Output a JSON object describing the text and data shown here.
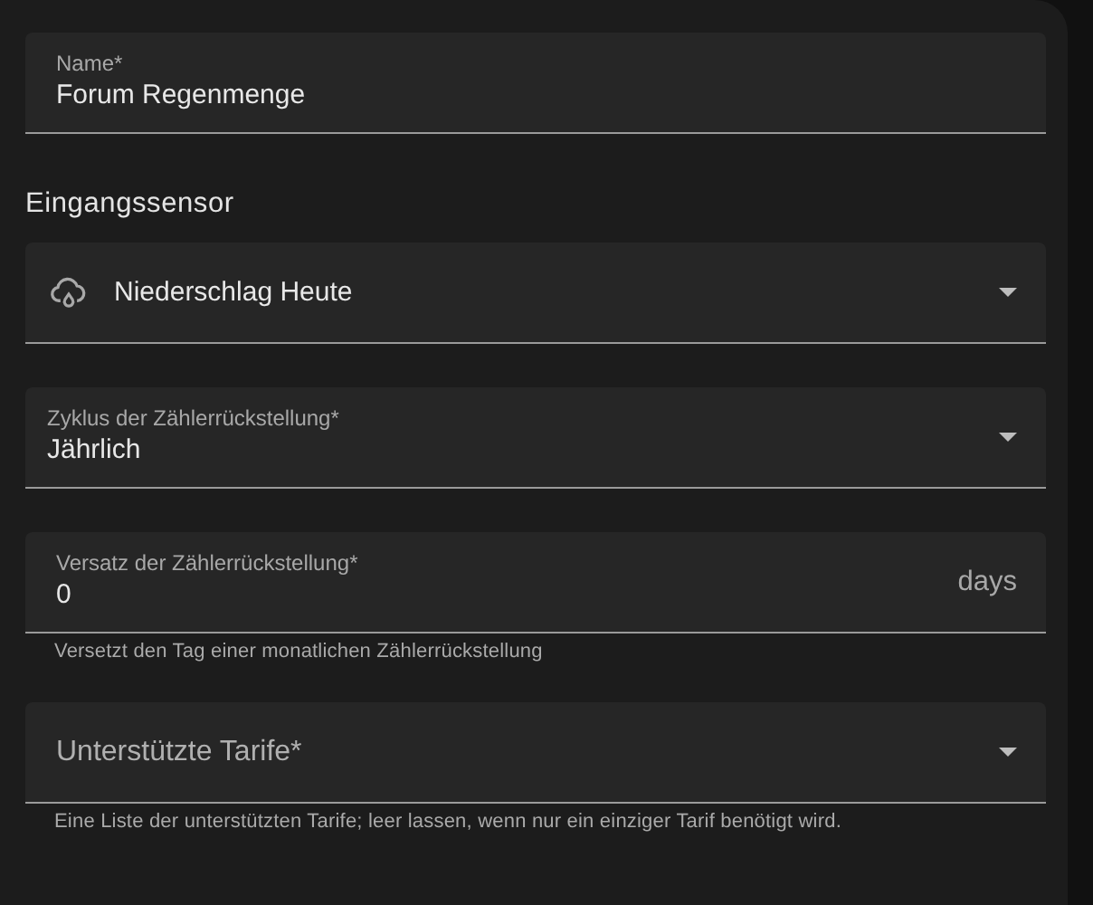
{
  "form": [
    {
      "kind": "text",
      "label": "Name*",
      "value": "Forum Regenmenge"
    },
    {
      "kind": "heading",
      "text": "Eingangssensor"
    },
    {
      "kind": "entity",
      "value": "Niederschlag Heute"
    },
    {
      "kind": "select",
      "label": "Zyklus der Zählerrückstellung*",
      "value": "Jährlich"
    },
    {
      "kind": "text",
      "label": "Versatz der Zählerrückstellung*",
      "value": "0",
      "suffix": "days",
      "helper": "Versetzt den Tag einer monatlichen Zählerrückstellung"
    },
    {
      "kind": "select",
      "placeholder": "Unterstützte Tarife*",
      "helper": "Eine Liste der unterstützten Tarife; leer lassen, wenn nur ein einziger Tarif benötigt wird."
    }
  ]
}
